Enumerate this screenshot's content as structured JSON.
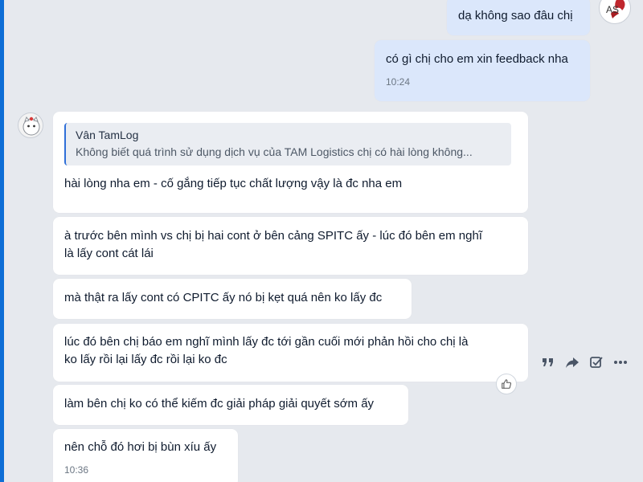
{
  "messages_out": [
    {
      "text": "dạ không sao đâu chị"
    },
    {
      "text": "có gì chị cho em xin feedback nha",
      "time": "10:24"
    }
  ],
  "reply_quote": {
    "sender": "Vân TamLog",
    "text": "Không biết quá trình sử dụng dịch vụ của TAM Logistics chị có hài lòng không..."
  },
  "messages_in": [
    {
      "text": "hài lòng nha em - cố gắng tiếp tục chất lượng vậy là đc nha em"
    },
    {
      "lines": [
        "à trước bên mình vs chị bị hai cont ở bên cảng SPITC ấy - lúc đó bên em nghĩ",
        "là lấy cont cát lái"
      ]
    },
    {
      "text": "mà thật ra lấy cont có CPITC ấy nó bị kẹt quá nên ko lấy đc"
    },
    {
      "lines": [
        "lúc đó bên chị báo em nghĩ mình lấy đc tới gần cuối mới phản hồi cho chị là",
        "ko lấy rồi lại lấy đc rồi lại ko đc"
      ]
    },
    {
      "text": "làm bên chị ko có thể kiếm đc giải pháp giải quyết sớm ấy"
    },
    {
      "text": "nên chỗ đó hơi bị bùn xíu ấy",
      "time": "10:36"
    }
  ],
  "my_avatar_initials": "AS",
  "icons": {
    "quote": "quote-icon",
    "forward": "forward-icon",
    "task": "task-icon",
    "more": "more-icon",
    "like": "thumbs-up-icon"
  },
  "colors": {
    "background": "#e6e9ee",
    "incoming_bubble": "#ffffff",
    "outgoing_bubble": "#dbe7fb",
    "quote_bar": "#2f6fd8"
  }
}
